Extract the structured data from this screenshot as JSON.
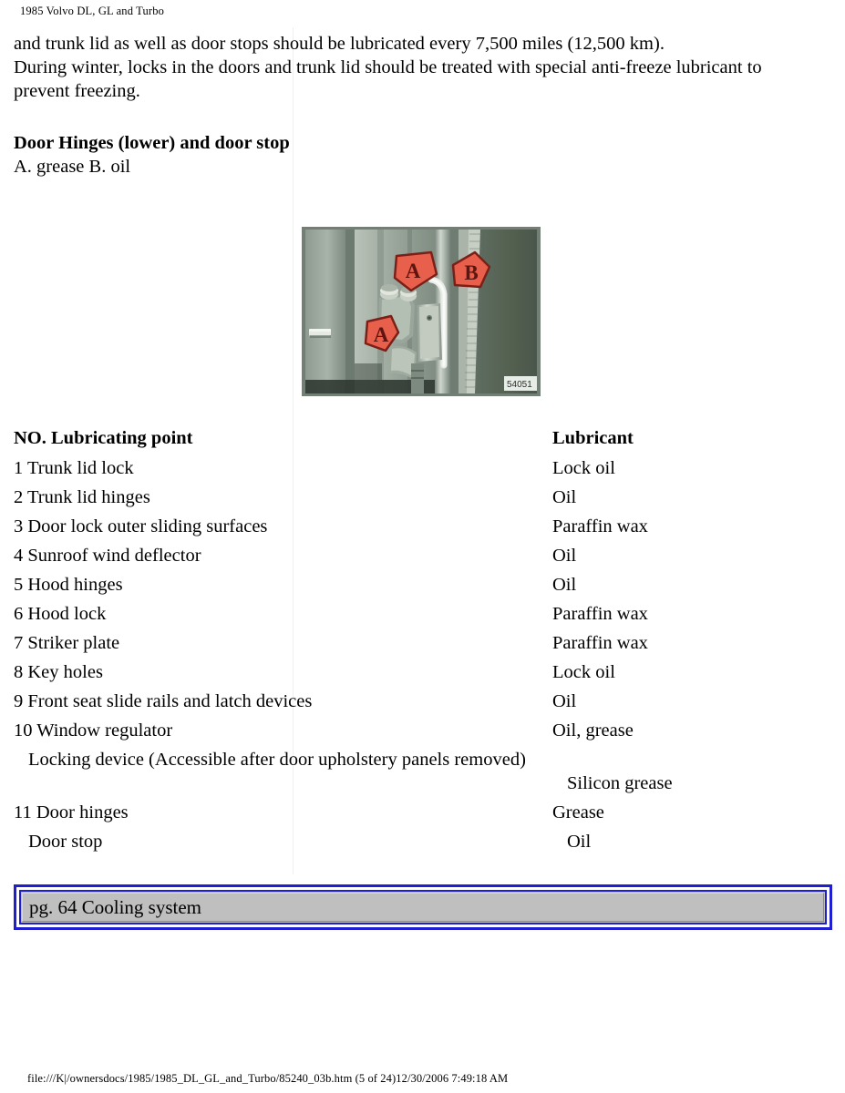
{
  "running_head": "1985 Volvo DL, GL and Turbo",
  "body": {
    "paragraph_lines": [
      "and trunk lid as well as door stops should be lubricated every 7,500 miles (12,500 km).",
      "During winter, locks in the doors and trunk lid should be treated with special anti-freeze lubricant to",
      "prevent freezing."
    ]
  },
  "section": {
    "heading": "Door Hinges (lower) and door stop",
    "legend": "A. grease B. oil"
  },
  "figure": {
    "caption_code": "54051",
    "markers": [
      {
        "label": "A",
        "position": "upper-center"
      },
      {
        "label": "B",
        "position": "upper-right"
      },
      {
        "label": "A",
        "position": "lower-left"
      }
    ],
    "alt": "Photo of lower door hinge and door stop with lubrication points marked A and B",
    "marker_color": "#e8604c",
    "marker_outline": "#7a2018"
  },
  "table": {
    "headers": {
      "point": "NO. Lubricating point",
      "lubricant": "Lubricant"
    },
    "rows": [
      {
        "point": "1 Trunk lid lock",
        "lubricant": "Lock oil",
        "indent": false,
        "tall": false
      },
      {
        "point": "2 Trunk lid hinges",
        "lubricant": "Oil",
        "indent": false,
        "tall": false
      },
      {
        "point": "3 Door lock outer sliding surfaces",
        "lubricant": "Paraffin wax",
        "indent": false,
        "tall": false
      },
      {
        "point": "4 Sunroof wind deflector",
        "lubricant": "Oil",
        "indent": false,
        "tall": false
      },
      {
        "point": "5 Hood hinges",
        "lubricant": "Oil",
        "indent": false,
        "tall": false
      },
      {
        "point": "6 Hood lock",
        "lubricant": "Paraffin wax",
        "indent": false,
        "tall": false
      },
      {
        "point": "7 Striker plate",
        "lubricant": "Paraffin wax",
        "indent": false,
        "tall": false
      },
      {
        "point": "8 Key holes",
        "lubricant": "Lock oil",
        "indent": false,
        "tall": false
      },
      {
        "point": "9 Front seat slide rails and latch devices",
        "lubricant": "Oil",
        "indent": false,
        "tall": false
      },
      {
        "point": "10 Window regulator",
        "lubricant": "Oil, grease",
        "indent": false,
        "tall": false
      },
      {
        "point": "Locking device (Accessible after door upholstery panels removed)",
        "lubricant": "Silicon grease",
        "indent": true,
        "tall": true
      },
      {
        "point": "11 Door hinges",
        "lubricant": "Grease",
        "indent": false,
        "tall": false
      },
      {
        "point": "Door stop",
        "lubricant": "Oil",
        "indent": true,
        "tall": false
      }
    ]
  },
  "nav_banner": {
    "label": "pg. 64 Cooling system",
    "border_color": "#1f1fd0",
    "face_color": "#bfbfbf"
  },
  "footer": {
    "text": "file:///K|/ownersdocs/1985/1985_DL_GL_and_Turbo/85240_03b.htm (5 of 24)12/30/2006 7:49:18 AM"
  }
}
